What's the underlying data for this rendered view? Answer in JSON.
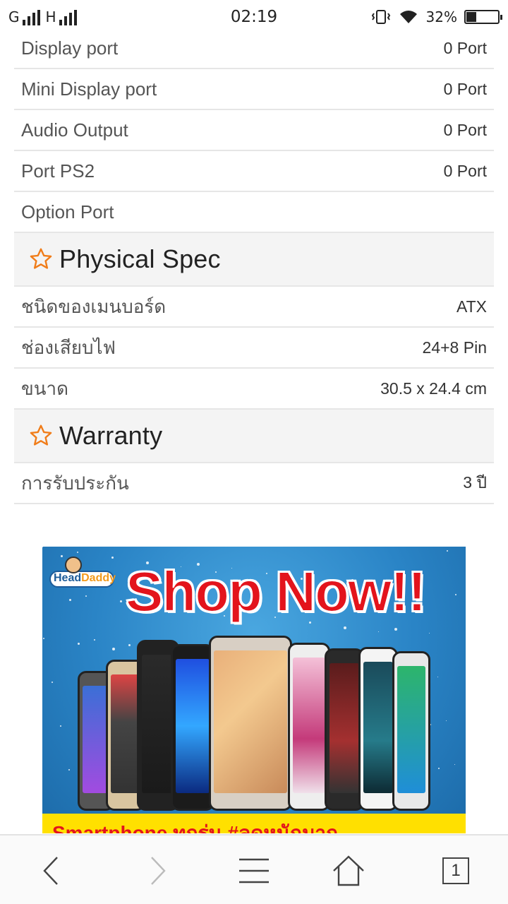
{
  "status_bar": {
    "carrier_left": "G",
    "network_type": "H",
    "time": "02:19",
    "battery_percent_text": "32%",
    "battery_level": 0.32
  },
  "rows_top": [
    {
      "label": "Display port",
      "value": "0 Port"
    },
    {
      "label": "Mini Display port",
      "value": "0 Port"
    },
    {
      "label": "Audio Output",
      "value": "0 Port"
    },
    {
      "label": "Port PS2",
      "value": "0 Port"
    },
    {
      "label": "Option Port",
      "value": ""
    }
  ],
  "section_physical": {
    "icon": "star-outline-icon",
    "title": "Physical Spec",
    "rows": [
      {
        "label": "ชนิดของเมนบอร์ด",
        "value": "ATX"
      },
      {
        "label": "ช่องเสียบไฟ",
        "value": "24+8 Pin"
      },
      {
        "label": "ขนาด",
        "value": "30.5 x 24.4 cm"
      }
    ]
  },
  "section_warranty": {
    "icon": "star-outline-icon",
    "title": "Warranty",
    "rows": [
      {
        "label": "การรับประกัน",
        "value": "3 ปี"
      }
    ]
  },
  "banner": {
    "logo_text_head": "Head",
    "logo_text_daddy": "Daddy",
    "headline": "Shop Now!!",
    "strip_text": "Smartphone ทุกรุ่น #ลดหนักมาก"
  },
  "nav": {
    "back_icon": "chevron-left-icon",
    "forward_icon": "chevron-right-icon",
    "menu_icon": "hamburger-icon",
    "home_icon": "home-icon",
    "tabs_count": "1"
  },
  "colors": {
    "accent_star": "#f07d1a",
    "section_bg": "#f4f4f4",
    "divider": "#e6e6e6",
    "banner_red": "#e3141c",
    "banner_yellow": "#ffe000"
  }
}
